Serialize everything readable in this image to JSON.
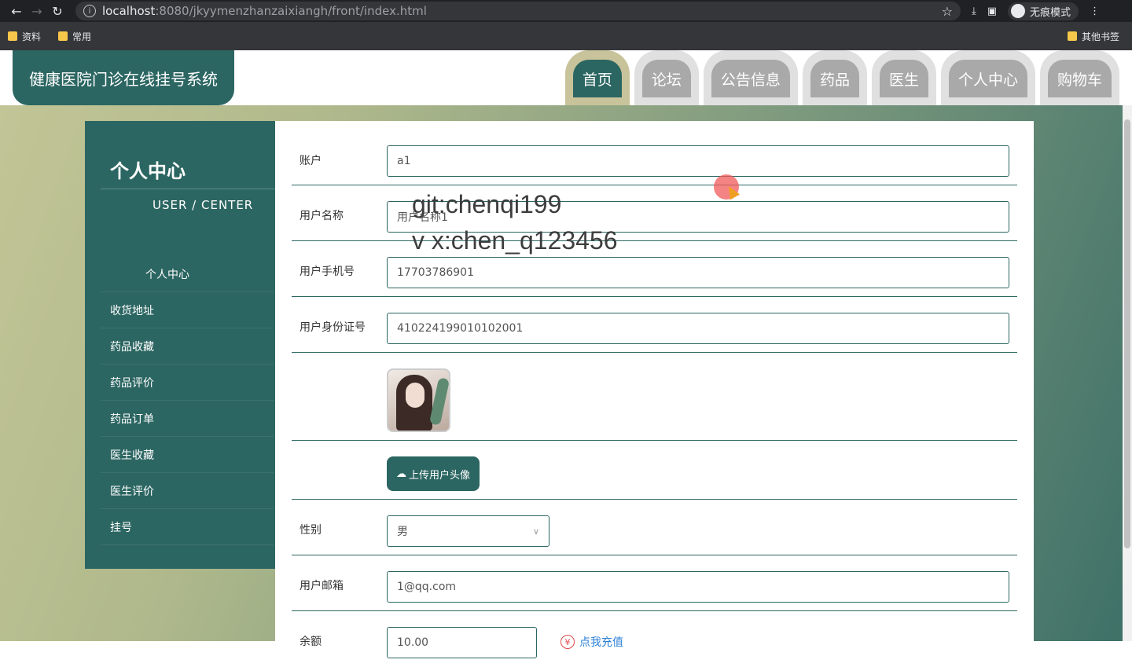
{
  "browser": {
    "url_host": "localhost",
    "url_path": ":8080/jkyymenzhanzaixiangh/front/index.html",
    "incognito_label": "无痕模式",
    "bookmarks": [
      "资料",
      "常用"
    ],
    "other_bookmarks": "其他书签"
  },
  "site": {
    "title": "健康医院门诊在线挂号系统",
    "nav": [
      "首页",
      "论坛",
      "公告信息",
      "药品",
      "医生",
      "个人中心",
      "购物车"
    ]
  },
  "sidebar": {
    "title": "个人中心",
    "subtitle": "USER / CENTER",
    "items": [
      "个人中心",
      "收货地址",
      "药品收藏",
      "药品评价",
      "药品订单",
      "医生收藏",
      "医生评价",
      "挂号"
    ]
  },
  "form": {
    "account_label": "账户",
    "account_value": "a1",
    "name_label": "用户名称",
    "name_value": "用户名称1",
    "phone_label": "用户手机号",
    "phone_value": "17703786901",
    "idcard_label": "用户身份证号",
    "idcard_value": "410224199010102001",
    "upload_label": "上传用户头像",
    "gender_label": "性别",
    "gender_value": "男",
    "email_label": "用户邮箱",
    "email_value": "1@qq.com",
    "balance_label": "余额",
    "balance_value": "10.00",
    "recharge_label": "点我充值"
  },
  "watermark": {
    "line1": "git:chenqi199",
    "line2": "v x:chen_q123456"
  },
  "colors": {
    "primary": "#2c6662",
    "nav_active_outer": "#c8c39b",
    "nav_inactive": "#a9a9a9"
  }
}
